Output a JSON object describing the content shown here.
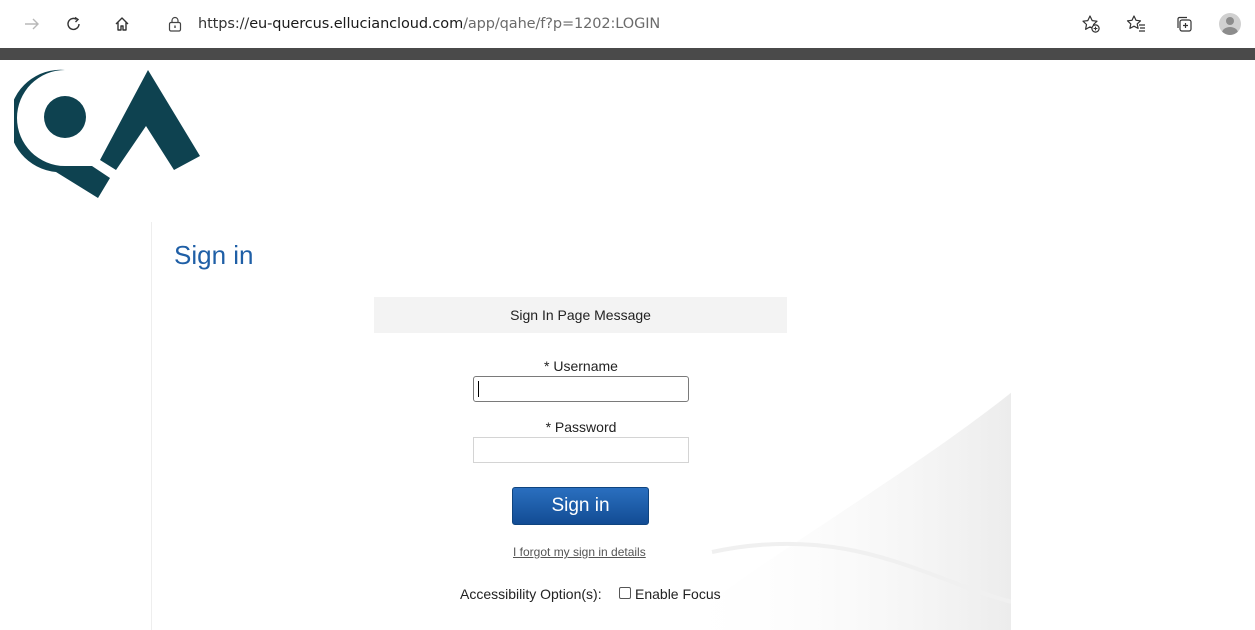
{
  "browser": {
    "url_scheme": "https://",
    "url_host": "eu-quercus.elluciancloud.com",
    "url_path": "/app/qahe/f?p=1202:LOGIN",
    "icons": [
      "forward-icon",
      "refresh-icon",
      "home-icon",
      "lock-icon",
      "add-favorite-icon",
      "favorites-icon",
      "collections-icon",
      "profile-avatar"
    ]
  },
  "logo": {
    "text": "QA",
    "color": "#0e4250"
  },
  "page": {
    "title": "Sign in",
    "message": "Sign In Page Message",
    "username_label": "* Username",
    "username_value": "",
    "password_label": "* Password",
    "password_value": "",
    "signin_button": "Sign in",
    "forgot_link": "I forgot my sign in details",
    "accessibility_label": "Accessibility Option(s):",
    "enable_focus_label": "Enable Focus",
    "enable_focus_checked": false
  },
  "colors": {
    "title": "#1f5fa6",
    "button": "#1a5aa6",
    "topbar": "#4a4a4a"
  }
}
